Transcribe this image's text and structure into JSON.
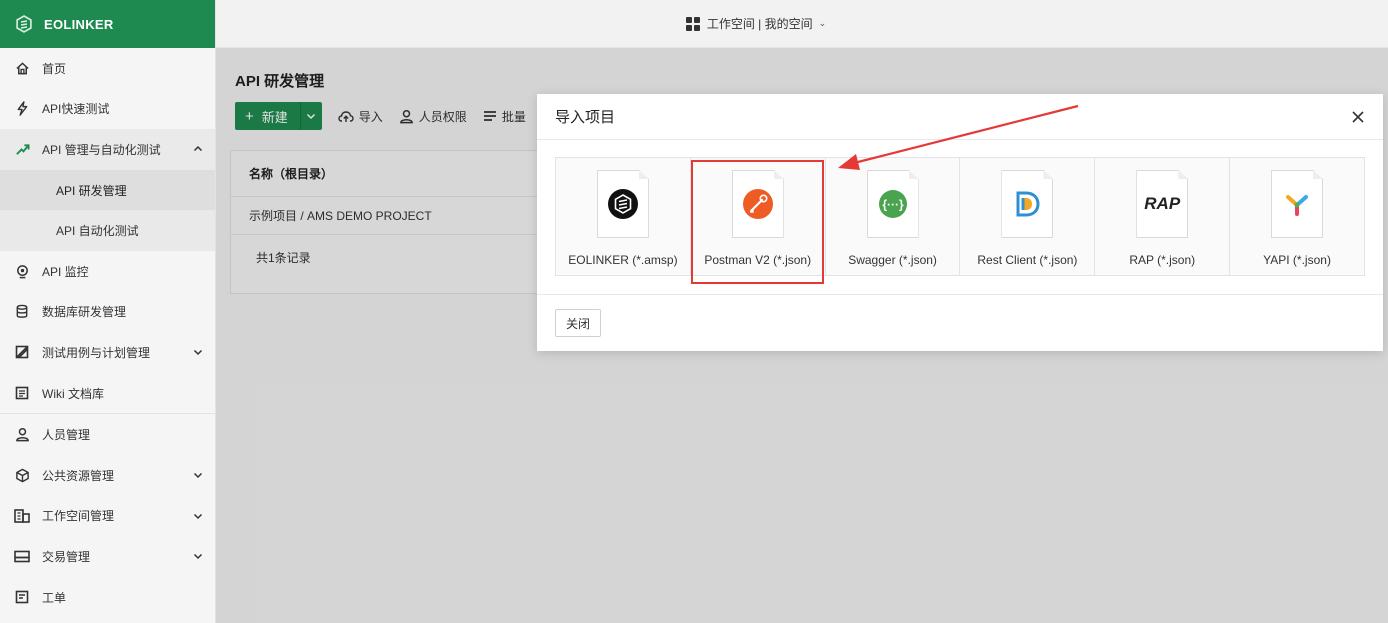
{
  "brand": {
    "name": "EOLINKER"
  },
  "sidebar": {
    "items": [
      {
        "label": "首页",
        "icon": "home-icon"
      },
      {
        "label": "API快速测试",
        "icon": "bolt-icon"
      },
      {
        "label": "API 管理与自动化测试",
        "icon": "api-management-icon",
        "expanded": true,
        "children": [
          {
            "label": "API 研发管理",
            "selected": true
          },
          {
            "label": "API 自动化测试"
          }
        ]
      },
      {
        "label": "API 监控",
        "icon": "monitor-icon"
      },
      {
        "label": "数据库研发管理",
        "icon": "database-icon"
      },
      {
        "label": "测试用例与计划管理",
        "icon": "testcase-icon"
      },
      {
        "label": "Wiki 文档库",
        "icon": "wiki-icon"
      },
      {
        "label": "人员管理",
        "icon": "user-icon"
      },
      {
        "label": "公共资源管理",
        "icon": "cube-icon"
      },
      {
        "label": "工作空间管理",
        "icon": "building-icon"
      },
      {
        "label": "交易管理",
        "icon": "card-icon"
      },
      {
        "label": "工单",
        "icon": "ticket-icon"
      }
    ]
  },
  "topbar": {
    "workspace": "工作空间 | 我的空间"
  },
  "page": {
    "title": "API 研发管理",
    "toolbar": {
      "new_label": "新建",
      "import_label": "导入",
      "permission_label": "人员权限",
      "batch_label": "批量"
    },
    "table": {
      "header": "名称（根目录）",
      "rows": [
        "示例项目 / AMS DEMO PROJECT"
      ],
      "footer": "共1条记录"
    }
  },
  "modal": {
    "title": "导入项目",
    "options": [
      {
        "label": "EOLINKER (*.amsp)",
        "logo": "eolinker-logo"
      },
      {
        "label": "Postman V2 (*.json)",
        "logo": "postman-logo",
        "highlighted": true
      },
      {
        "label": "Swagger (*.json)",
        "logo": "swagger-logo"
      },
      {
        "label": "Rest Client (*.json)",
        "logo": "restclient-logo"
      },
      {
        "label": "RAP (*.json)",
        "logo": "rap-logo",
        "logo_text": "RAP"
      },
      {
        "label": "YAPI (*.json)",
        "logo": "yapi-logo"
      }
    ],
    "close_label": "关闭"
  },
  "colors": {
    "brand_green": "#1e8a4f",
    "annotation_red": "#e53935"
  }
}
